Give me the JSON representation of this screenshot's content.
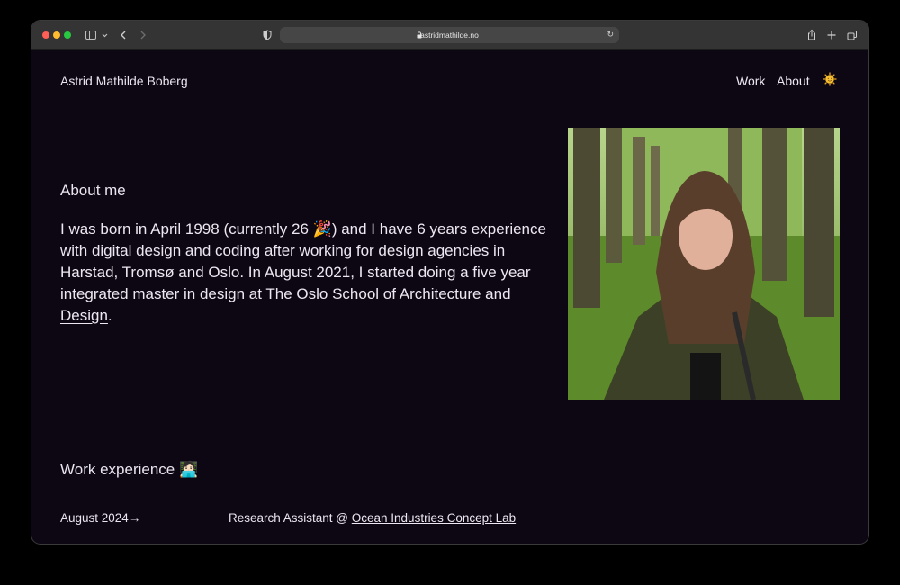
{
  "browser": {
    "url": "astridmathilde.no"
  },
  "header": {
    "site_title": "Astrid Mathilde Boberg",
    "nav": {
      "work": "Work",
      "about": "About"
    },
    "theme_icon": "sun-emoji-icon"
  },
  "about": {
    "heading": "About me",
    "text_before_emoji": "I was born in April 1998 (currently 26 ",
    "emoji": "🎉",
    "text_after_emoji": ") and I have 6 years experience with digital design and coding after working for design agencies in Harstad, Tromsø and Oslo. In August 2021, I started doing a five year integrated master in design at ",
    "school_link": "The Oslo School of Architecture and Design",
    "text_end": "."
  },
  "work": {
    "heading": "Work experience",
    "heading_emoji": "🧑🏻‍💻",
    "entries": [
      {
        "date": "August 2024",
        "arrow": "→",
        "role": "Research Assistant @ ",
        "org_link": "Ocean Industries Concept Lab"
      }
    ]
  },
  "colors": {
    "page_background": "#0d0714",
    "text": "#ece7f0",
    "titlebar": "#343434"
  }
}
